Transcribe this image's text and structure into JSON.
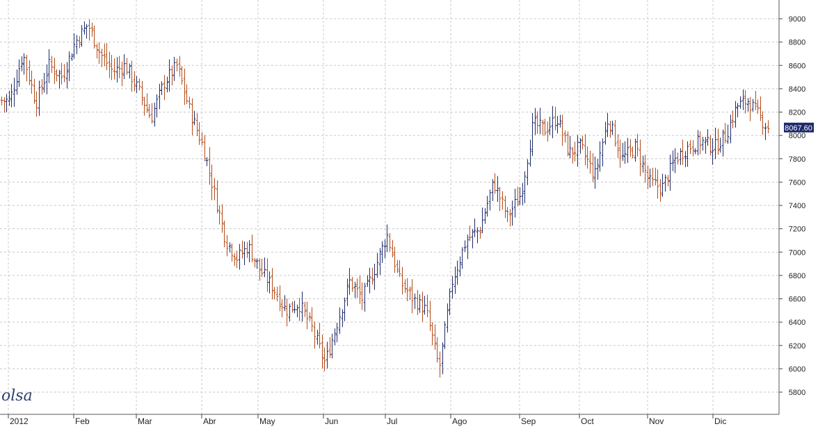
{
  "watermark": "olsa",
  "chart_data": {
    "type": "ohlc",
    "title": "",
    "xlabel": "",
    "ylabel": "",
    "ylim": [
      5650,
      9100
    ],
    "y_ticks": [
      5800,
      6000,
      6200,
      6400,
      6600,
      6800,
      7000,
      7200,
      7400,
      7600,
      7800,
      8000,
      8200,
      8400,
      8600,
      8800,
      9000
    ],
    "x_tick_labels": [
      "2012",
      "Feb",
      "Mar",
      "Abr",
      "May",
      "Jun",
      "Jul",
      "Ago",
      "Sep",
      "Oct",
      "Nov",
      "Dic"
    ],
    "last_price_label": "8067.60",
    "grid": true,
    "colors": {
      "up": "#1c2a6b",
      "down": "#b24a18",
      "grid": "#c8c8c8",
      "label_bg": "#1c2a6b"
    },
    "anchors": [
      [
        "2012",
        8300
      ],
      [
        "2012",
        8700
      ],
      [
        "2012",
        8280
      ],
      [
        "2012",
        8600
      ],
      [
        "2012",
        8500
      ],
      [
        "Feb",
        8800
      ],
      [
        "Feb",
        8950
      ],
      [
        "Feb",
        8700
      ],
      [
        "Feb",
        8550
      ],
      [
        "Feb",
        8600
      ],
      [
        "Mar",
        8400
      ],
      [
        "Mar",
        8150
      ],
      [
        "Mar",
        8450
      ],
      [
        "Mar",
        8600
      ],
      [
        "Mar",
        8200
      ],
      [
        "Abr",
        7900
      ],
      [
        "Abr",
        7500
      ],
      [
        "Abr",
        7100
      ],
      [
        "Abr",
        6950
      ],
      [
        "Abr",
        7050
      ],
      [
        "May",
        6850
      ],
      [
        "May",
        6700
      ],
      [
        "May",
        6500
      ],
      [
        "May",
        6560
      ],
      [
        "May",
        6350
      ],
      [
        "Jun",
        6050
      ],
      [
        "Jun",
        6400
      ],
      [
        "Jun",
        6750
      ],
      [
        "Jun",
        6600
      ],
      [
        "Jun",
        6850
      ],
      [
        "Jul",
        7150
      ],
      [
        "Jul",
        6750
      ],
      [
        "Jul",
        6600
      ],
      [
        "Jul",
        6500
      ],
      [
        "Jul",
        6000
      ],
      [
        "Ago",
        6750
      ],
      [
        "Ago",
        7100
      ],
      [
        "Ago",
        7200
      ],
      [
        "Ago",
        7600
      ],
      [
        "Ago",
        7300
      ],
      [
        "Sep",
        7500
      ],
      [
        "Sep",
        8100
      ],
      [
        "Sep",
        8050
      ],
      [
        "Sep",
        8150
      ],
      [
        "Sep",
        7850
      ],
      [
        "Oct",
        7900
      ],
      [
        "Oct",
        7650
      ],
      [
        "Oct",
        8150
      ],
      [
        "Oct",
        7800
      ],
      [
        "Oct",
        7900
      ],
      [
        "Nov",
        7600
      ],
      [
        "Nov",
        7550
      ],
      [
        "Nov",
        7800
      ],
      [
        "Nov",
        7900
      ],
      [
        "Nov",
        7950
      ],
      [
        "Dic",
        7900
      ],
      [
        "Dic",
        8000
      ],
      [
        "Dic",
        8250
      ],
      [
        "Dic",
        8300
      ],
      [
        "Dic",
        8067.6
      ]
    ]
  }
}
